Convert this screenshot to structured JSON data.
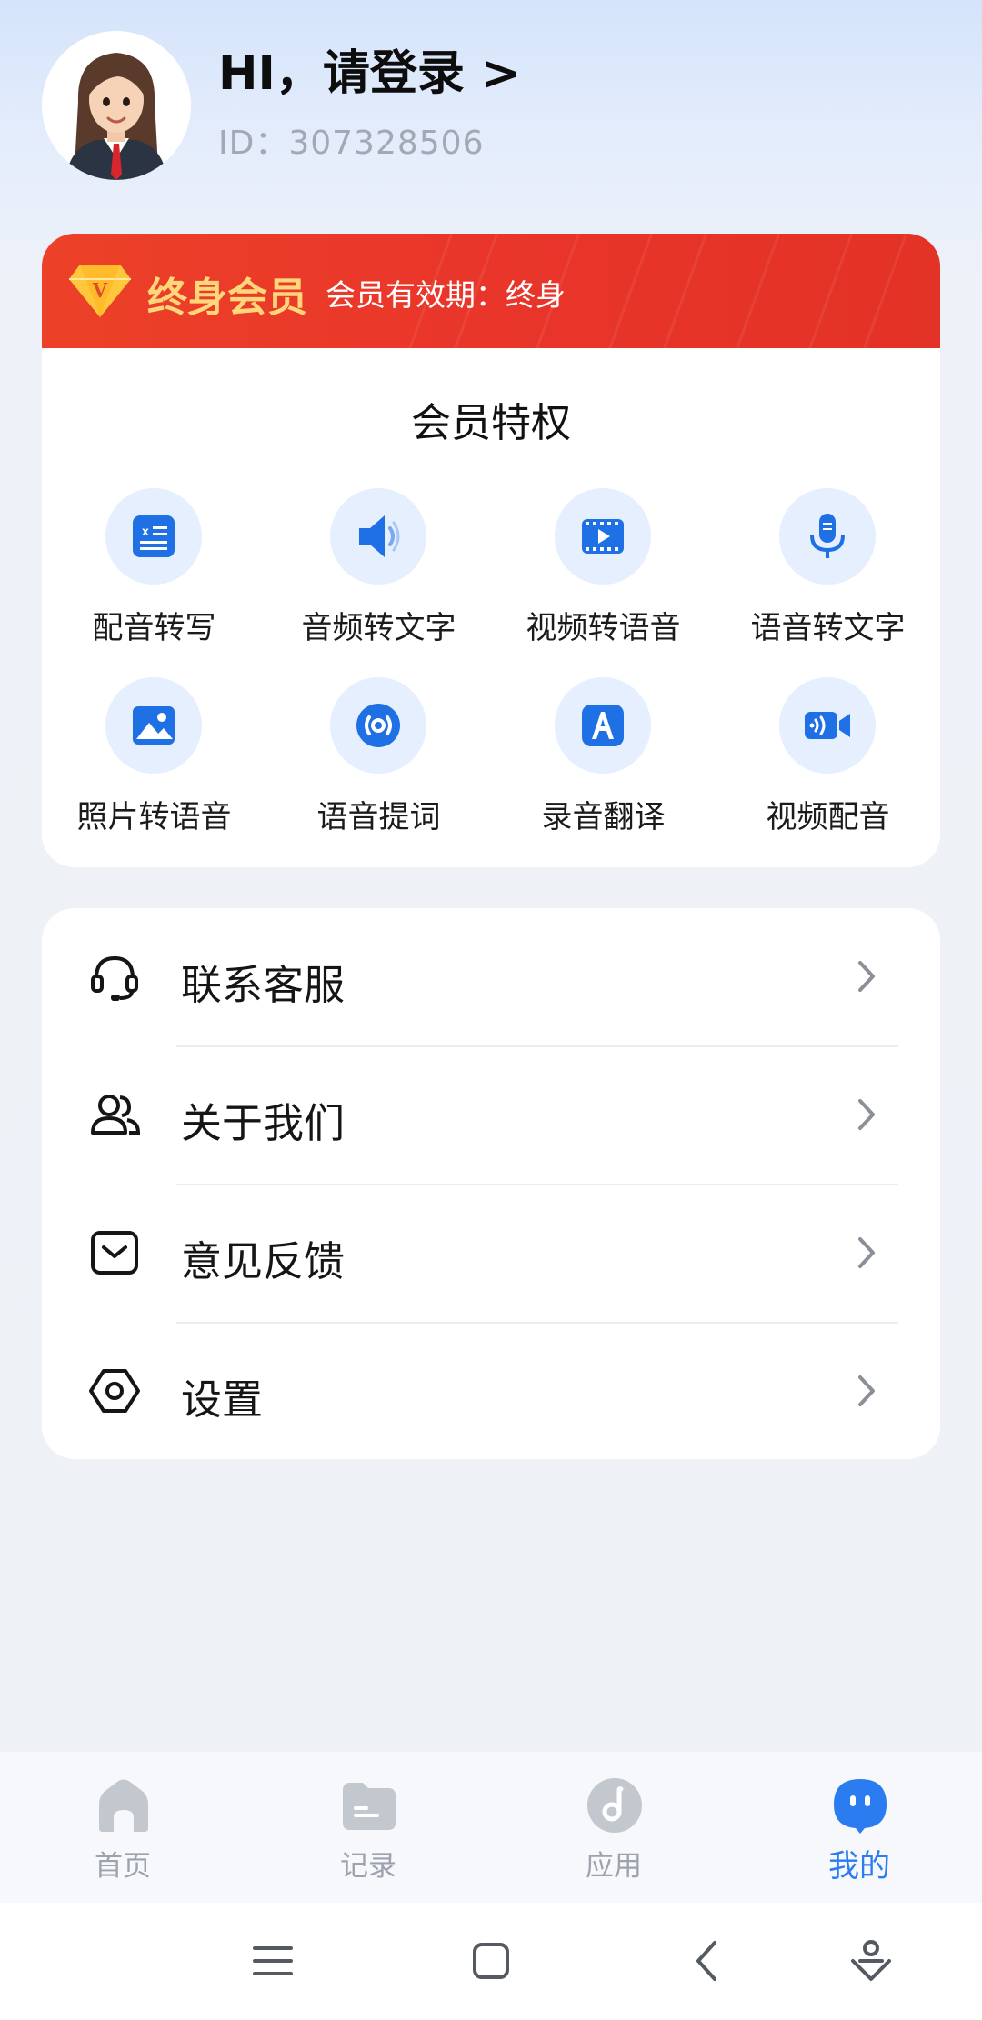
{
  "header": {
    "greeting": "HI，请登录 >",
    "id_label": "ID：",
    "id_value": "307328506"
  },
  "member": {
    "title": "终身会员",
    "validity": "会员有效期：终身",
    "privileges_title": "会员特权",
    "privileges": [
      {
        "label": "配音转写",
        "icon": "document-edit-icon"
      },
      {
        "label": "音频转文字",
        "icon": "speaker-icon"
      },
      {
        "label": "视频转语音",
        "icon": "video-play-icon"
      },
      {
        "label": "语音转文字",
        "icon": "microphone-icon"
      },
      {
        "label": "照片转语音",
        "icon": "image-icon"
      },
      {
        "label": "语音提词",
        "icon": "broadcast-icon"
      },
      {
        "label": "录音翻译",
        "icon": "translate-icon"
      },
      {
        "label": "视频配音",
        "icon": "video-camera-icon"
      }
    ],
    "accent_color": "#e9352a",
    "title_color": "#ffd77a"
  },
  "menu": {
    "items": [
      {
        "label": "联系客服",
        "icon": "headset-icon"
      },
      {
        "label": "关于我们",
        "icon": "users-icon"
      },
      {
        "label": "意见反馈",
        "icon": "feedback-icon"
      },
      {
        "label": "设置",
        "icon": "settings-icon"
      }
    ]
  },
  "tabbar": {
    "items": [
      {
        "label": "首页",
        "icon": "home-icon",
        "active": false
      },
      {
        "label": "记录",
        "icon": "folder-icon",
        "active": false
      },
      {
        "label": "应用",
        "icon": "music-note-icon",
        "active": false
      },
      {
        "label": "我的",
        "icon": "chat-bubble-icon",
        "active": true
      }
    ],
    "active_color": "#2b7cf0",
    "inactive_color": "#9da3ad"
  },
  "system_nav": {
    "buttons": [
      "menu-icon",
      "home-square-icon",
      "back-icon",
      "assistant-icon"
    ]
  }
}
